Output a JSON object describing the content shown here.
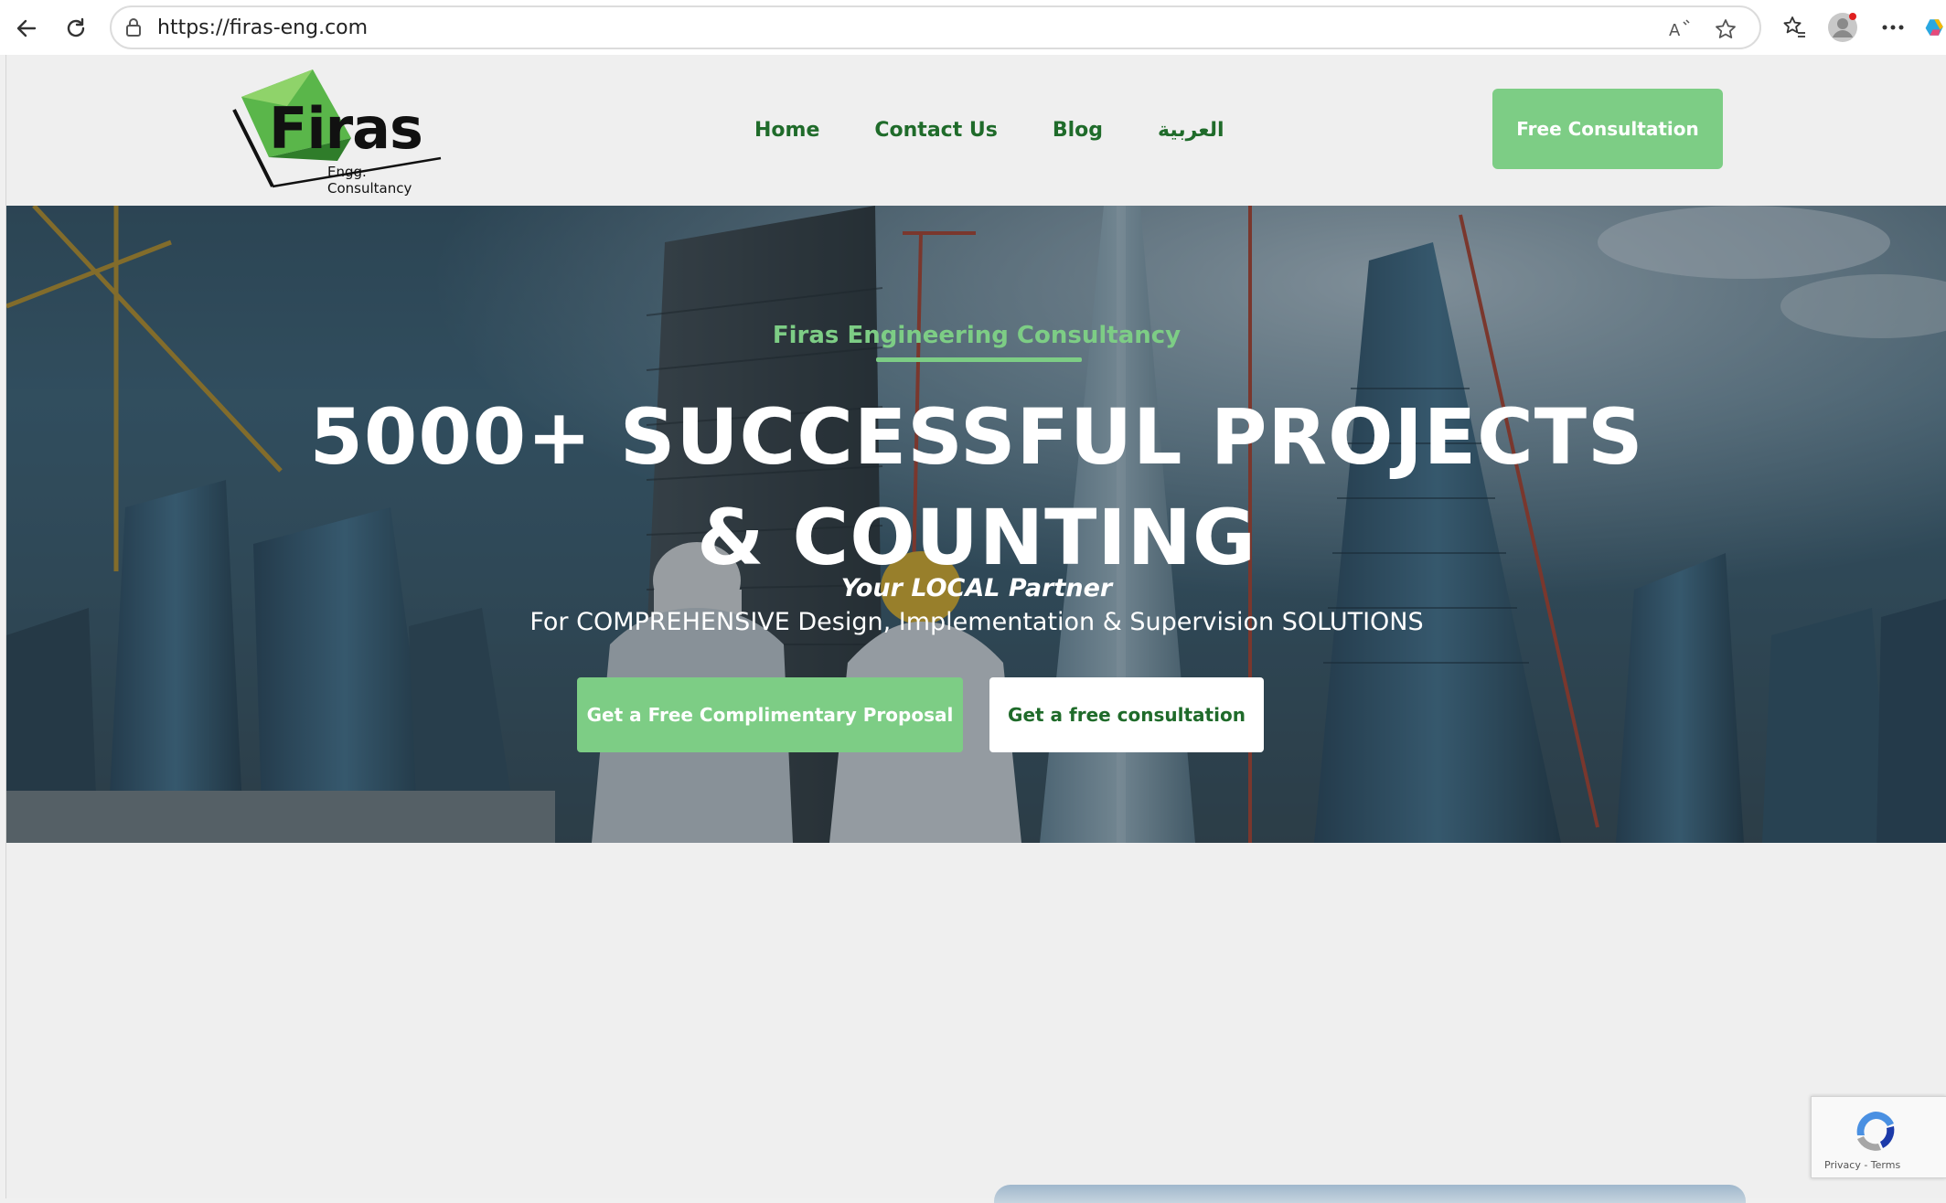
{
  "browser": {
    "url": "https://firas-eng.com"
  },
  "header": {
    "logo_word": "Firas",
    "logo_sub": "Engg. Consultancy",
    "nav": [
      {
        "label": "Home"
      },
      {
        "label": "Contact Us"
      },
      {
        "label": "Blog"
      },
      {
        "label": "العربية"
      }
    ],
    "cta_label": "Free Consultation"
  },
  "hero": {
    "eyebrow": "Firas Engineering Consultancy",
    "title": "5000+ SUCCESSFUL PROJECTS & COUNTING",
    "tagline": "Your LOCAL Partner",
    "subtitle": "For COMPREHENSIVE Design, Implementation & Supervision SOLUTIONS",
    "primary_button": "Get a Free Complimentary Proposal",
    "secondary_button": "Get a free consultation"
  },
  "recaptcha": {
    "links": "Privacy - Terms"
  },
  "colors": {
    "accent_green": "#7dcd85",
    "nav_green": "#1f6b2a"
  }
}
